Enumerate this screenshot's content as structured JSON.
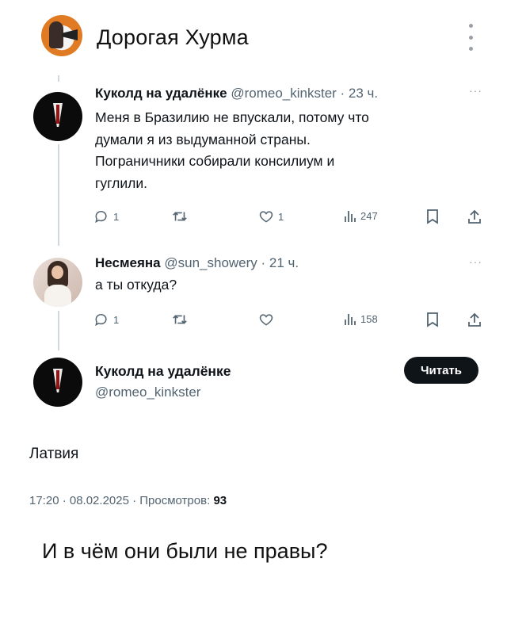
{
  "channel": {
    "title": "Дорогая Хурма"
  },
  "tweets": [
    {
      "name": "Куколд на удалёнке",
      "meta": "@romeo_kinkster · 23 ч.",
      "more": "···",
      "lines": [
        "Меня в Бразилию не впускали, потому что",
        "думали я из выдуманной страны.",
        "Пограничники собирали консилиум и",
        "гуглили."
      ],
      "actions": {
        "replies": "1",
        "retweets": "",
        "likes": "1",
        "views": "247"
      }
    },
    {
      "name": "Несмеяна",
      "meta": "@sun_showery · 21 ч.",
      "more": "···",
      "lines": [
        "а ты откуда?"
      ],
      "actions": {
        "replies": "1",
        "retweets": "",
        "likes": "",
        "views": "158"
      }
    }
  ],
  "main_tweet": {
    "name": "Куколд на удалёнке",
    "handle": "@romeo_kinkster",
    "follow_label": "Читать",
    "text": "Латвия",
    "timestamp": "17:20 · 08.02.2025 · Просмотров:",
    "views": "93"
  },
  "caption": "И в чём они были не правы?"
}
